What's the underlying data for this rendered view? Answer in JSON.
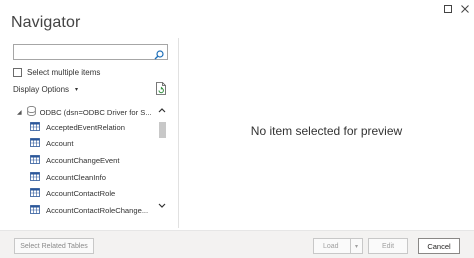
{
  "window": {
    "minimize_icon": "minimize-icon",
    "close_icon": "close-icon"
  },
  "title": "Navigator",
  "search": {
    "value": "",
    "placeholder": "",
    "icon": "search-icon"
  },
  "select_multiple": {
    "label": "Select multiple items",
    "checked": false
  },
  "display_options": {
    "label": "Display Options",
    "caret": "▾"
  },
  "tree": {
    "root": {
      "label": "ODBC (dsn=ODBC Driver for S...",
      "expanded": true
    },
    "items": [
      {
        "label": "AcceptedEventRelation"
      },
      {
        "label": "Account"
      },
      {
        "label": "AccountChangeEvent"
      },
      {
        "label": "AccountCleanInfo"
      },
      {
        "label": "AccountContactRole"
      },
      {
        "label": "AccountContactRoleChange..."
      }
    ]
  },
  "preview": {
    "empty_message": "No item selected for preview"
  },
  "footer": {
    "select_related_label": "Select Related Tables",
    "load_label": "Load",
    "load_caret": "▾",
    "edit_label": "Edit",
    "cancel_label": "Cancel"
  },
  "colors": {
    "accent_blue": "#1e6fb8",
    "footer_bg": "#f3f2f1",
    "border": "#a6a6a6"
  }
}
